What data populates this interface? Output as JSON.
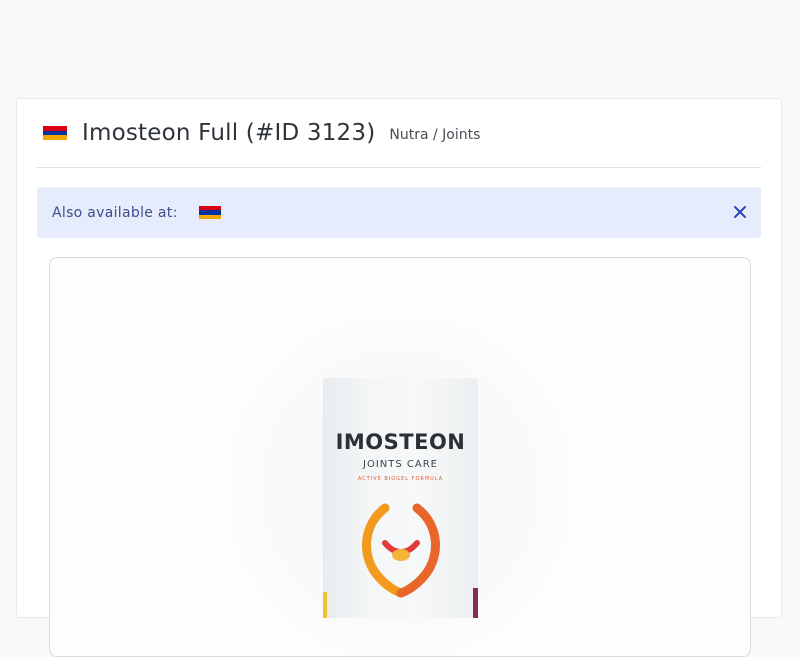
{
  "offer": {
    "title": "Imosteon Full (#ID 3123)",
    "category": "Nutra / Joints",
    "flag_icon": "armenia-flag-icon"
  },
  "alert": {
    "label": "Also available at:",
    "flag_icon": "armenia-flag-icon",
    "close_icon": "close-icon"
  },
  "product": {
    "brand": "IMOSTEON",
    "subtitle": "JOINTS CARE",
    "tagline": "ACTIVE BIOGEL FORMULA"
  },
  "colors": {
    "flag_red": "#d90012",
    "flag_blue": "#0033a0",
    "flag_orange": "#f2a800",
    "alert_bg": "#e6ecfb",
    "alert_text": "#3a4f8c",
    "close_icon": "#2d47b8"
  }
}
